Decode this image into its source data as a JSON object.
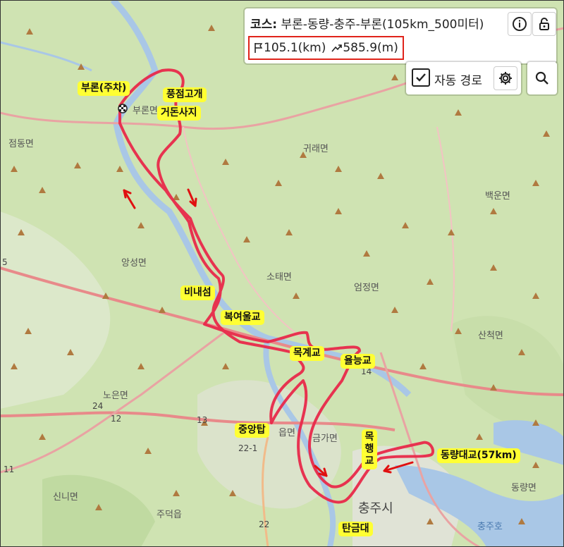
{
  "course": {
    "label": "코스:",
    "name": "부론-동량-충주-부론(105km_500미터)",
    "distance": "105.1(km)",
    "elevation": "585.9(m)"
  },
  "controls": {
    "auto_route_label": "자동 경로",
    "auto_route_checked": true
  },
  "route_labels": [
    "부론(주차)",
    "풍점고개",
    "거돈사지",
    "비내섬",
    "복여울교",
    "목계교",
    "율능교",
    "중앙탑",
    "목",
    "행",
    "교",
    "동량대교(57km)",
    "탄금대"
  ],
  "place_names": [
    "부론면",
    "점동면",
    "귀래면",
    "백운면",
    "앙성면",
    "소태면",
    "엄정면",
    "산척면",
    "노은면",
    "금가면",
    "신니면",
    "주덕읍",
    "충주시",
    "동량면",
    "충주호",
    "읍면"
  ],
  "road_numbers": [
    "24",
    "12",
    "13",
    "22-1",
    "11",
    "22",
    "14",
    "5"
  ],
  "colors": {
    "route": "#e8294a",
    "highlight": "#ffff33",
    "river": "#a9c7e6",
    "arrow": "#e01010"
  }
}
